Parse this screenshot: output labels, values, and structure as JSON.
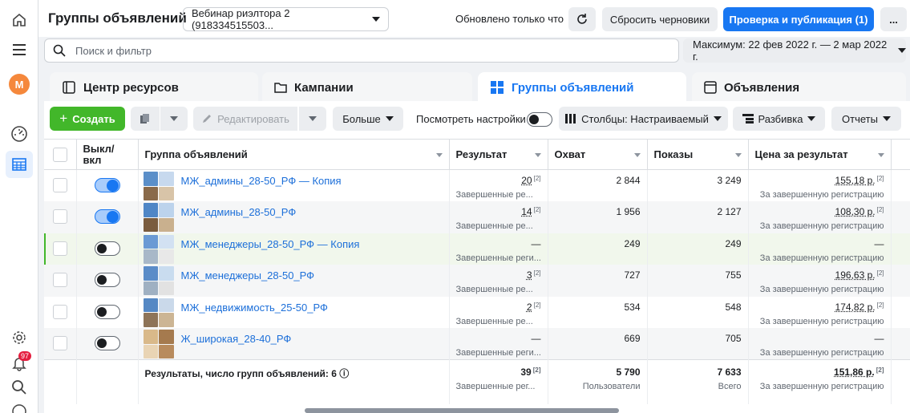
{
  "nav": {
    "avatar_letter": "М",
    "notif_count": "97"
  },
  "header": {
    "title": "Группы объявлений",
    "account": "Вебинар риэлтора 2 (918334515503...",
    "updated": "Обновлено только что",
    "discard": "Сбросить черновики",
    "publish": "Проверка и публикация (1)",
    "more": "..."
  },
  "search": {
    "placeholder": "Поиск и фильтр"
  },
  "daterange": "Максимум: 22 фев 2022 г. — 2 мар 2022 г.",
  "tabs": [
    "Центр ресурсов",
    "Кампании",
    "Группы объявлений",
    "Объявления"
  ],
  "toolbar": {
    "create": "Создать",
    "edit": "Редактировать",
    "more": "Больше",
    "view_settings": "Посмотреть настройки",
    "columns": "Столбцы: Настраиваемый",
    "breakdown": "Разбивка",
    "reports": "Отчеты"
  },
  "columns": [
    "Выкл/\nвкл",
    "Группа объявлений",
    "Результат",
    "Охват",
    "Показы",
    "Цена за результат"
  ],
  "rows": [
    {
      "name": "МЖ_админы_28-50_РФ — Копия",
      "on": true,
      "result": "20",
      "result_sub": "Завершенные ре...",
      "reach": "2 844",
      "impressions": "3 249",
      "cost": "155,18 р.",
      "cost_sub": "За завершенную регистрацию"
    },
    {
      "name": "МЖ_админы_28-50_РФ",
      "on": true,
      "result": "14",
      "result_sub": "Завершенные ре...",
      "reach": "1 956",
      "impressions": "2 127",
      "cost": "108,30 р.",
      "cost_sub": "За завершенную регистрацию"
    },
    {
      "name": "МЖ_менеджеры_28-50_РФ — Копия",
      "on": false,
      "result": "—",
      "result_sub": "Завершенные реги...",
      "reach": "249",
      "impressions": "249",
      "cost": "—",
      "cost_sub": "За завершенную регистрацию"
    },
    {
      "name": "МЖ_менеджеры_28-50_РФ",
      "on": false,
      "result": "3",
      "result_sub": "Завершенные ре...",
      "reach": "727",
      "impressions": "755",
      "cost": "196,63 р.",
      "cost_sub": "За завершенную регистрацию"
    },
    {
      "name": "МЖ_недвижимость_25-50_РФ",
      "on": false,
      "result": "2",
      "result_sub": "Завершенные ре...",
      "reach": "534",
      "impressions": "548",
      "cost": "174,82 р.",
      "cost_sub": "За завершенную регистрацию"
    },
    {
      "name": "Ж_широкая_28-40_РФ",
      "on": false,
      "result": "—",
      "result_sub": "Завершенные реги...",
      "reach": "669",
      "impressions": "705",
      "cost": "—",
      "cost_sub": "За завершенную регистрацию"
    }
  ],
  "totals": {
    "label": "Результаты, число групп объявлений: 6",
    "result": "39",
    "result_sub": "Завершенные рег...",
    "reach": "5 790",
    "reach_sub": "Пользователи",
    "impressions": "7 633",
    "impressions_sub": "Всего",
    "cost": "151,86 р.",
    "cost_sub": "За завершенную регистрацию"
  },
  "colors": {
    "primary": "#1877f2",
    "create": "#42b72a",
    "link": "#1c6fd9"
  },
  "sup_mark": "[2]"
}
